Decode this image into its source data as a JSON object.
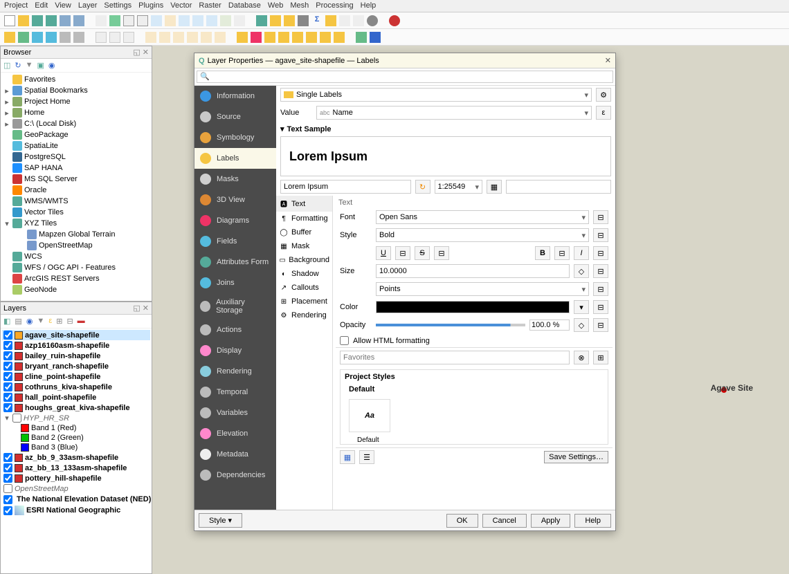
{
  "menu": [
    "Project",
    "Edit",
    "View",
    "Layer",
    "Settings",
    "Plugins",
    "Vector",
    "Raster",
    "Database",
    "Web",
    "Mesh",
    "Processing",
    "Help"
  ],
  "browser": {
    "title": "Browser",
    "dock_icons": [
      "minimize",
      "close"
    ],
    "items": [
      {
        "arrow": "",
        "icon": "star",
        "label": "Favorites",
        "color": "#f5c542"
      },
      {
        "arrow": "▸",
        "icon": "bookmark",
        "label": "Spatial Bookmarks",
        "color": "#5b9bd5"
      },
      {
        "arrow": "▸",
        "icon": "home",
        "label": "Project Home",
        "color": "#8a6"
      },
      {
        "arrow": "▸",
        "icon": "home",
        "label": "Home",
        "color": "#8a6"
      },
      {
        "arrow": "▸",
        "icon": "disk",
        "label": "C:\\ (Local Disk)",
        "color": "#999"
      },
      {
        "arrow": "",
        "icon": "gpkg",
        "label": "GeoPackage",
        "color": "#6b8"
      },
      {
        "arrow": "",
        "icon": "feather",
        "label": "SpatiaLite",
        "color": "#5bd"
      },
      {
        "arrow": "",
        "icon": "pg",
        "label": "PostgreSQL",
        "color": "#336791"
      },
      {
        "arrow": "",
        "icon": "sap",
        "label": "SAP HANA",
        "color": "#1e90ff"
      },
      {
        "arrow": "",
        "icon": "mssql",
        "label": "MS SQL Server",
        "color": "#c33"
      },
      {
        "arrow": "",
        "icon": "oracle",
        "label": "Oracle",
        "color": "#f80"
      },
      {
        "arrow": "",
        "icon": "wms",
        "label": "WMS/WMTS",
        "color": "#5a9"
      },
      {
        "arrow": "",
        "icon": "vtile",
        "label": "Vector Tiles",
        "color": "#39c"
      },
      {
        "arrow": "▾",
        "icon": "xyz",
        "label": "XYZ Tiles",
        "color": "#5a9"
      },
      {
        "arrow": "",
        "icon": "grid",
        "label": "Mapzen Global Terrain",
        "indent": 20,
        "color": "#79c"
      },
      {
        "arrow": "",
        "icon": "grid",
        "label": "OpenStreetMap",
        "indent": 20,
        "color": "#79c"
      },
      {
        "arrow": "",
        "icon": "wcs",
        "label": "WCS",
        "color": "#5a9"
      },
      {
        "arrow": "",
        "icon": "wfs",
        "label": "WFS / OGC API - Features",
        "color": "#5a9"
      },
      {
        "arrow": "",
        "icon": "arcgis",
        "label": "ArcGIS REST Servers",
        "color": "#d44"
      },
      {
        "arrow": "",
        "icon": "geonode",
        "label": "GeoNode",
        "color": "#ac6"
      }
    ]
  },
  "layers": {
    "title": "Layers",
    "dock_icons": [
      "minimize",
      "close"
    ],
    "items": [
      {
        "check": true,
        "swatch": "#f9a825",
        "label": "agave_site-shapefile",
        "bold": true,
        "selected": true
      },
      {
        "check": true,
        "swatch": "#d32f2f",
        "label": "azp16160asm-shapefile",
        "bold": true
      },
      {
        "check": true,
        "swatch": "#d32f2f",
        "label": "bailey_ruin-shapefile",
        "bold": true
      },
      {
        "check": true,
        "swatch": "#d32f2f",
        "label": "bryant_ranch-shapefile",
        "bold": true
      },
      {
        "check": true,
        "swatch": "#d32f2f",
        "label": "cline_point-shapefile",
        "bold": true
      },
      {
        "check": true,
        "swatch": "#d32f2f",
        "label": "cothruns_kiva-shapefile",
        "bold": true
      },
      {
        "check": true,
        "swatch": "#d32f2f",
        "label": "hall_point-shapefile",
        "bold": true
      },
      {
        "check": true,
        "swatch": "#d32f2f",
        "label": "houghs_great_kiva-shapefile",
        "bold": true
      },
      {
        "check": false,
        "swatch": "",
        "label": "HYP_HR_SR",
        "italic": true,
        "arrow": "▾"
      },
      {
        "check": null,
        "swatch": "#ff0000",
        "label": "Band 1 (Red)",
        "indent": 24
      },
      {
        "check": null,
        "swatch": "#00c000",
        "label": "Band 2 (Green)",
        "indent": 24
      },
      {
        "check": null,
        "swatch": "#0000ff",
        "label": "Band 3 (Blue)",
        "indent": 24
      },
      {
        "check": true,
        "swatch": "#d32f2f",
        "label": "az_bb_9_33asm-shapefile",
        "bold": true
      },
      {
        "check": true,
        "swatch": "#d32f2f",
        "label": "az_bb_13_133asm-shapefile",
        "bold": true
      },
      {
        "check": true,
        "swatch": "#d32f2f",
        "label": "pottery_hill-shapefile",
        "bold": true
      },
      {
        "check": false,
        "swatch": "",
        "label": "OpenStreetMap",
        "italic": true
      },
      {
        "check": true,
        "swatch": "",
        "label": "The National Elevation Dataset (NED)",
        "bold": true,
        "icon": "raster"
      },
      {
        "check": true,
        "swatch": "",
        "label": "ESRI National Geographic",
        "bold": true,
        "icon": "raster"
      }
    ]
  },
  "dialog": {
    "title": "Layer Properties — agave_site-shapefile — Labels",
    "search_placeholder": "",
    "sidebar": [
      {
        "label": "Information",
        "color": "#3b97e3"
      },
      {
        "label": "Source",
        "color": "#c9c9c9"
      },
      {
        "label": "Symbology",
        "color": "#e8a23c"
      },
      {
        "label": "Labels",
        "color": "#f5c542",
        "active": true
      },
      {
        "label": "Masks",
        "color": "#cfcfcf"
      },
      {
        "label": "3D View",
        "color": "#d83"
      },
      {
        "label": "Diagrams",
        "color": "#e36"
      },
      {
        "label": "Fields",
        "color": "#5bd"
      },
      {
        "label": "Attributes Form",
        "color": "#5a9"
      },
      {
        "label": "Joins",
        "color": "#5bd"
      },
      {
        "label": "Auxiliary Storage",
        "color": "#bbb"
      },
      {
        "label": "Actions",
        "color": "#bbb"
      },
      {
        "label": "Display",
        "color": "#f8c"
      },
      {
        "label": "Rendering",
        "color": "#8cd"
      },
      {
        "label": "Temporal",
        "color": "#bbb"
      },
      {
        "label": "Variables",
        "color": "#bbb"
      },
      {
        "label": "Elevation",
        "color": "#f8c"
      },
      {
        "label": "Metadata",
        "color": "#eee"
      },
      {
        "label": "Dependencies",
        "color": "#bbb"
      }
    ],
    "mode": "Single Labels",
    "value_field": "Name",
    "collapse_header": "Text Sample",
    "preview_text": "Lorem Ipsum",
    "preview_input": "Lorem Ipsum",
    "scale": "1:25549",
    "sub_tabs": [
      "Text",
      "Formatting",
      "Buffer",
      "Mask",
      "Background",
      "Shadow",
      "Callouts",
      "Placement",
      "Rendering"
    ],
    "sub_tab_active": 0,
    "text_section": "Text",
    "font_label": "Font",
    "font_value": "Open Sans",
    "style_label": "Style",
    "style_value": "Bold",
    "underline_btn": "U",
    "strike_btn": "S",
    "bold_btn": "B",
    "italic_btn": "I",
    "size_label": "Size",
    "size_value": "10.0000",
    "size_unit": "Points",
    "color_label": "Color",
    "opacity_label": "Opacity",
    "opacity_value": "100.0 %",
    "allow_html": "Allow HTML formatting",
    "favorites_placeholder": "Favorites",
    "proj_styles": "Project Styles",
    "default_hdr": "Default",
    "swatch_text": "Aa",
    "swatch_caption": "Default",
    "save_settings": "Save Settings…",
    "style_btn": "Style",
    "ok": "OK",
    "cancel": "Cancel",
    "apply": "Apply",
    "help": "Help"
  },
  "map": {
    "point_label": "Agave Site"
  }
}
